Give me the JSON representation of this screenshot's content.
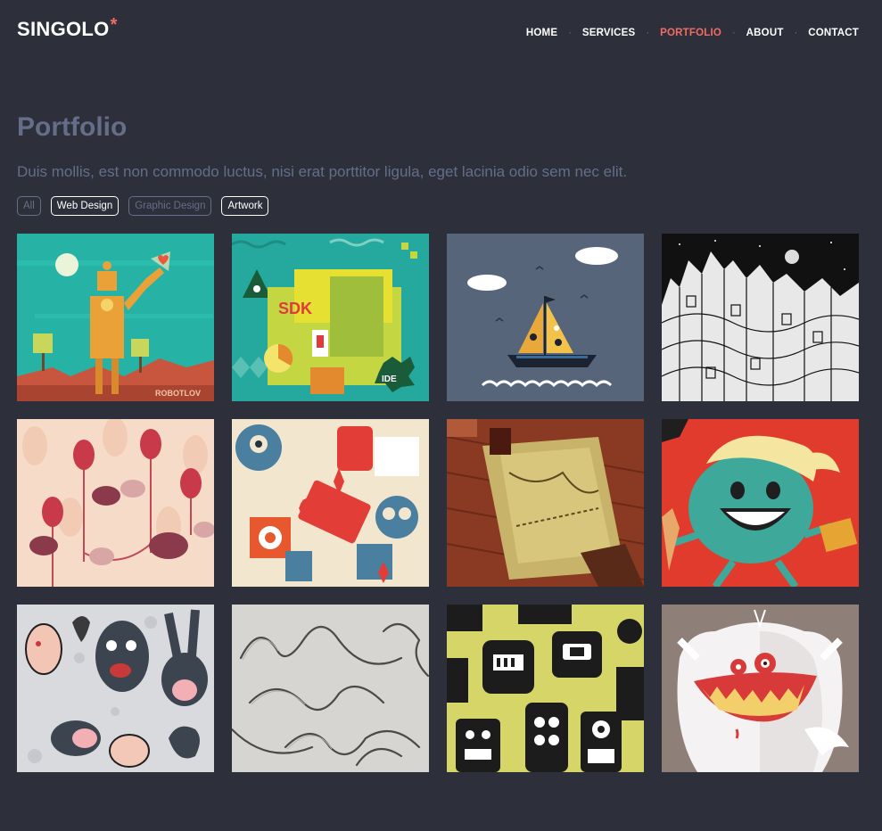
{
  "header": {
    "logo_text": "SINGOLO",
    "logo_star": "*",
    "nav": [
      {
        "label": "HOME",
        "active": false
      },
      {
        "label": "SERVICES",
        "active": false
      },
      {
        "label": "PORTFOLIO",
        "active": true
      },
      {
        "label": "ABOUT",
        "active": false
      },
      {
        "label": "CONTACT",
        "active": false
      }
    ],
    "nav_separator": "·"
  },
  "portfolio": {
    "title": "Portfolio",
    "subtitle": "Duis mollis, est non commodo luctus, nisi erat porttitor ligula, eget lacinia odio sem nec elit.",
    "filters": [
      {
        "label": "All",
        "active": false
      },
      {
        "label": "Web Design",
        "active": true
      },
      {
        "label": "Graphic Design",
        "active": false
      },
      {
        "label": "Artwork",
        "active": true
      }
    ],
    "tiles": [
      {
        "name": "robot-illustration",
        "text": "ROBOTLOV"
      },
      {
        "name": "sdk-city-illustration",
        "text": [
          "SDK",
          "IDE"
        ]
      },
      {
        "name": "sailboat-illustration"
      },
      {
        "name": "doodle-city-illustration"
      },
      {
        "name": "birds-eggs-pattern"
      },
      {
        "name": "robots-pattern"
      },
      {
        "name": "torn-paper-artwork"
      },
      {
        "name": "smiling-character-illustration"
      },
      {
        "name": "monsters-doodle"
      },
      {
        "name": "video-killed-radio-star-typography"
      },
      {
        "name": "robot-faces-pattern"
      },
      {
        "name": "white-monster-illustration"
      }
    ]
  },
  "colors": {
    "background": "#2d303a",
    "accent": "#f06c64",
    "muted": "#666d89",
    "text": "#ffffff"
  }
}
